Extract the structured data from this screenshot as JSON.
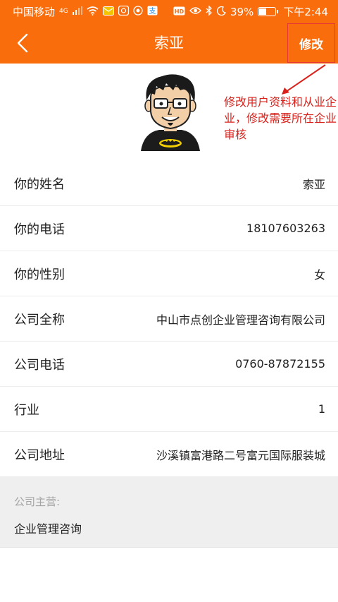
{
  "status_bar": {
    "carrier": "中国移动",
    "network": "4G",
    "battery_percent": "39%",
    "battery_level": 0.39,
    "time": "下午2:44",
    "icons": [
      "signal-icon",
      "wifi-icon",
      "message-icon",
      "chat-icon",
      "app-icon",
      "alipay-icon",
      "hd-icon",
      "eye-icon",
      "bluetooth-icon",
      "moon-icon",
      "battery-icon"
    ]
  },
  "nav": {
    "back_icon": "chevron-left-icon",
    "title": "索亚",
    "edit_label": "修改"
  },
  "annotation": {
    "text": "修改用户资料和从业企业，修改需要所在企业审核",
    "color": "#d9221c"
  },
  "profile": {
    "avatar": "cartoon-avatar"
  },
  "info": [
    {
      "label": "你的姓名",
      "value": "索亚"
    },
    {
      "label": "你的电话",
      "value": "18107603263"
    },
    {
      "label": "你的性别",
      "value": "女"
    },
    {
      "label": "公司全称",
      "value": "中山市点创企业管理咨询有限公司"
    },
    {
      "label": "公司电话",
      "value": "0760-87872155"
    },
    {
      "label": "行业",
      "value": "1"
    },
    {
      "label": "公司地址",
      "value": "沙溪镇富港路二号富元国际服装城"
    }
  ],
  "business": {
    "label": "公司主营:",
    "value": "企业管理咨询"
  },
  "colors": {
    "accent": "#f96d0d",
    "annotation": "#d9221c"
  }
}
